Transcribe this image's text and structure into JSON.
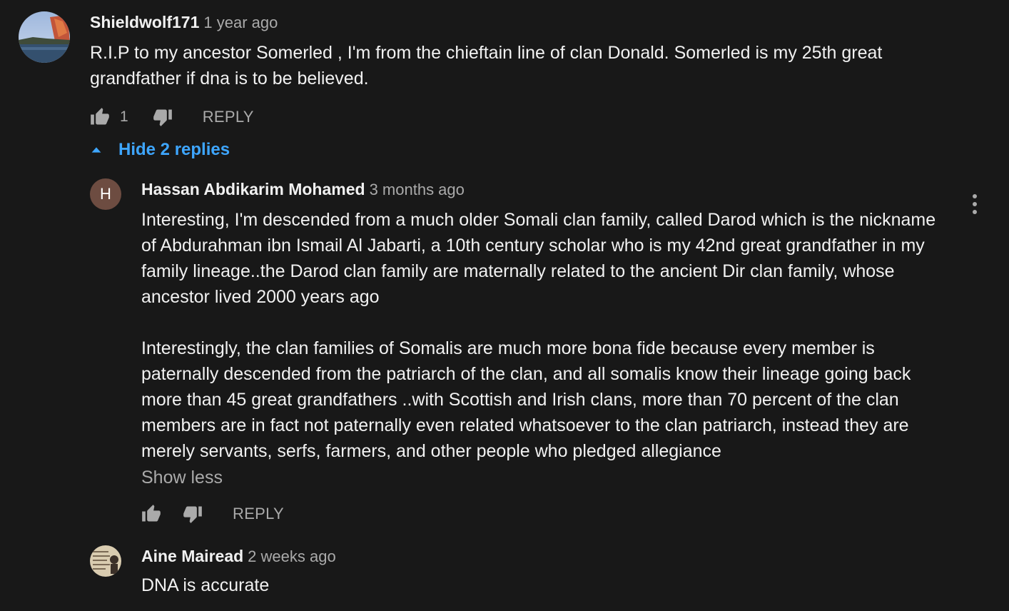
{
  "comments": [
    {
      "author": "Shieldwolf171",
      "time": "1 year ago",
      "text": "R.I.P to my ancestor Somerled , I'm from the chieftain line of clan Donald. Somerled is my 25th great grandfather if dna is to be believed.",
      "likes": "1",
      "reply_label": "REPLY",
      "hide_replies_label": "Hide 2 replies",
      "replies": [
        {
          "author": "Hassan Abdikarim Mohamed",
          "time": "3 months ago",
          "avatar_letter": "H",
          "avatar_color": "#6d4c41",
          "text": "Interesting, I'm descended from a much older Somali clan family, called Darod which is the nickname of Abdurahman ibn Ismail Al Jabarti, a 10th century scholar who is my 42nd great grandfather in my family lineage..the Darod clan family are maternally related to the ancient Dir clan family, whose ancestor lived 2000 years ago\n\nInterestingly, the clan families of Somalis are much more bona fide because every member is paternally descended from the patriarch of the clan, and all somalis know their lineage going back more than 45 great grandfathers ..with Scottish and Irish clans, more than 70 percent of the clan members are in fact not paternally even related whatsoever to the clan patriarch, instead they are merely servants, serfs, farmers, and other people who pledged allegiance",
          "show_less_label": "Show less",
          "reply_label": "REPLY"
        },
        {
          "author": "Aine Mairead",
          "time": "2 weeks ago",
          "text": "DNA is accurate"
        }
      ]
    }
  ],
  "colors": {
    "background": "#181818",
    "text_primary": "#f1f1f1",
    "text_secondary": "#aaaaaa",
    "link_blue": "#3ea6ff"
  },
  "icons": [
    "thumbs-up-icon",
    "thumbs-down-icon",
    "caret-up-icon",
    "more-vert-icon"
  ]
}
